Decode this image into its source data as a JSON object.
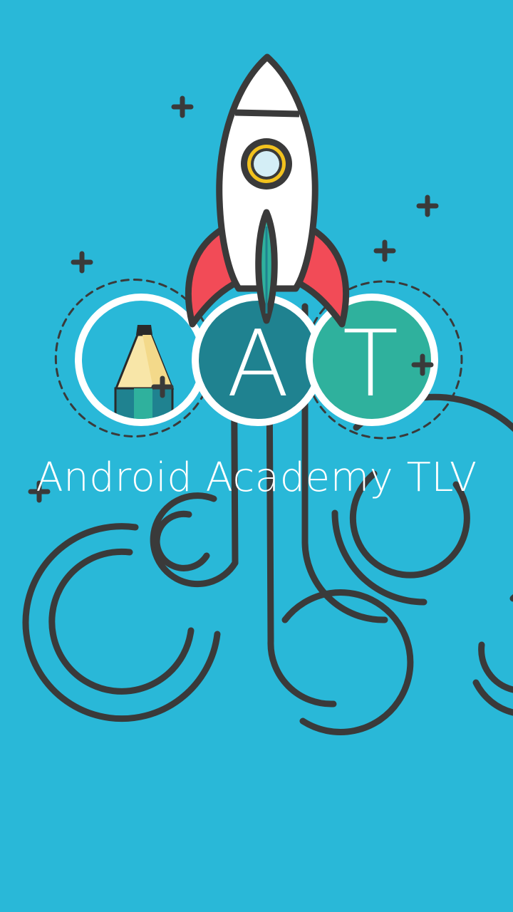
{
  "app": {
    "title": "Android Academy TLV"
  },
  "logo": {
    "letter_a": "A",
    "letter_t": "T"
  },
  "icons": {
    "rocket": "rocket-icon",
    "pencil": "pencil-icon",
    "sparkle": "plus-sparkle-icon"
  },
  "colors": {
    "background": "#29b8d8",
    "circle_light": "#29b8d8",
    "circle_dark": "#1f8290",
    "circle_green": "#2fb19d",
    "rocket_body": "#ffffff",
    "rocket_fins": "#f24b57",
    "porthole_ring": "#f2c21e",
    "outline": "#3a3a3a"
  }
}
